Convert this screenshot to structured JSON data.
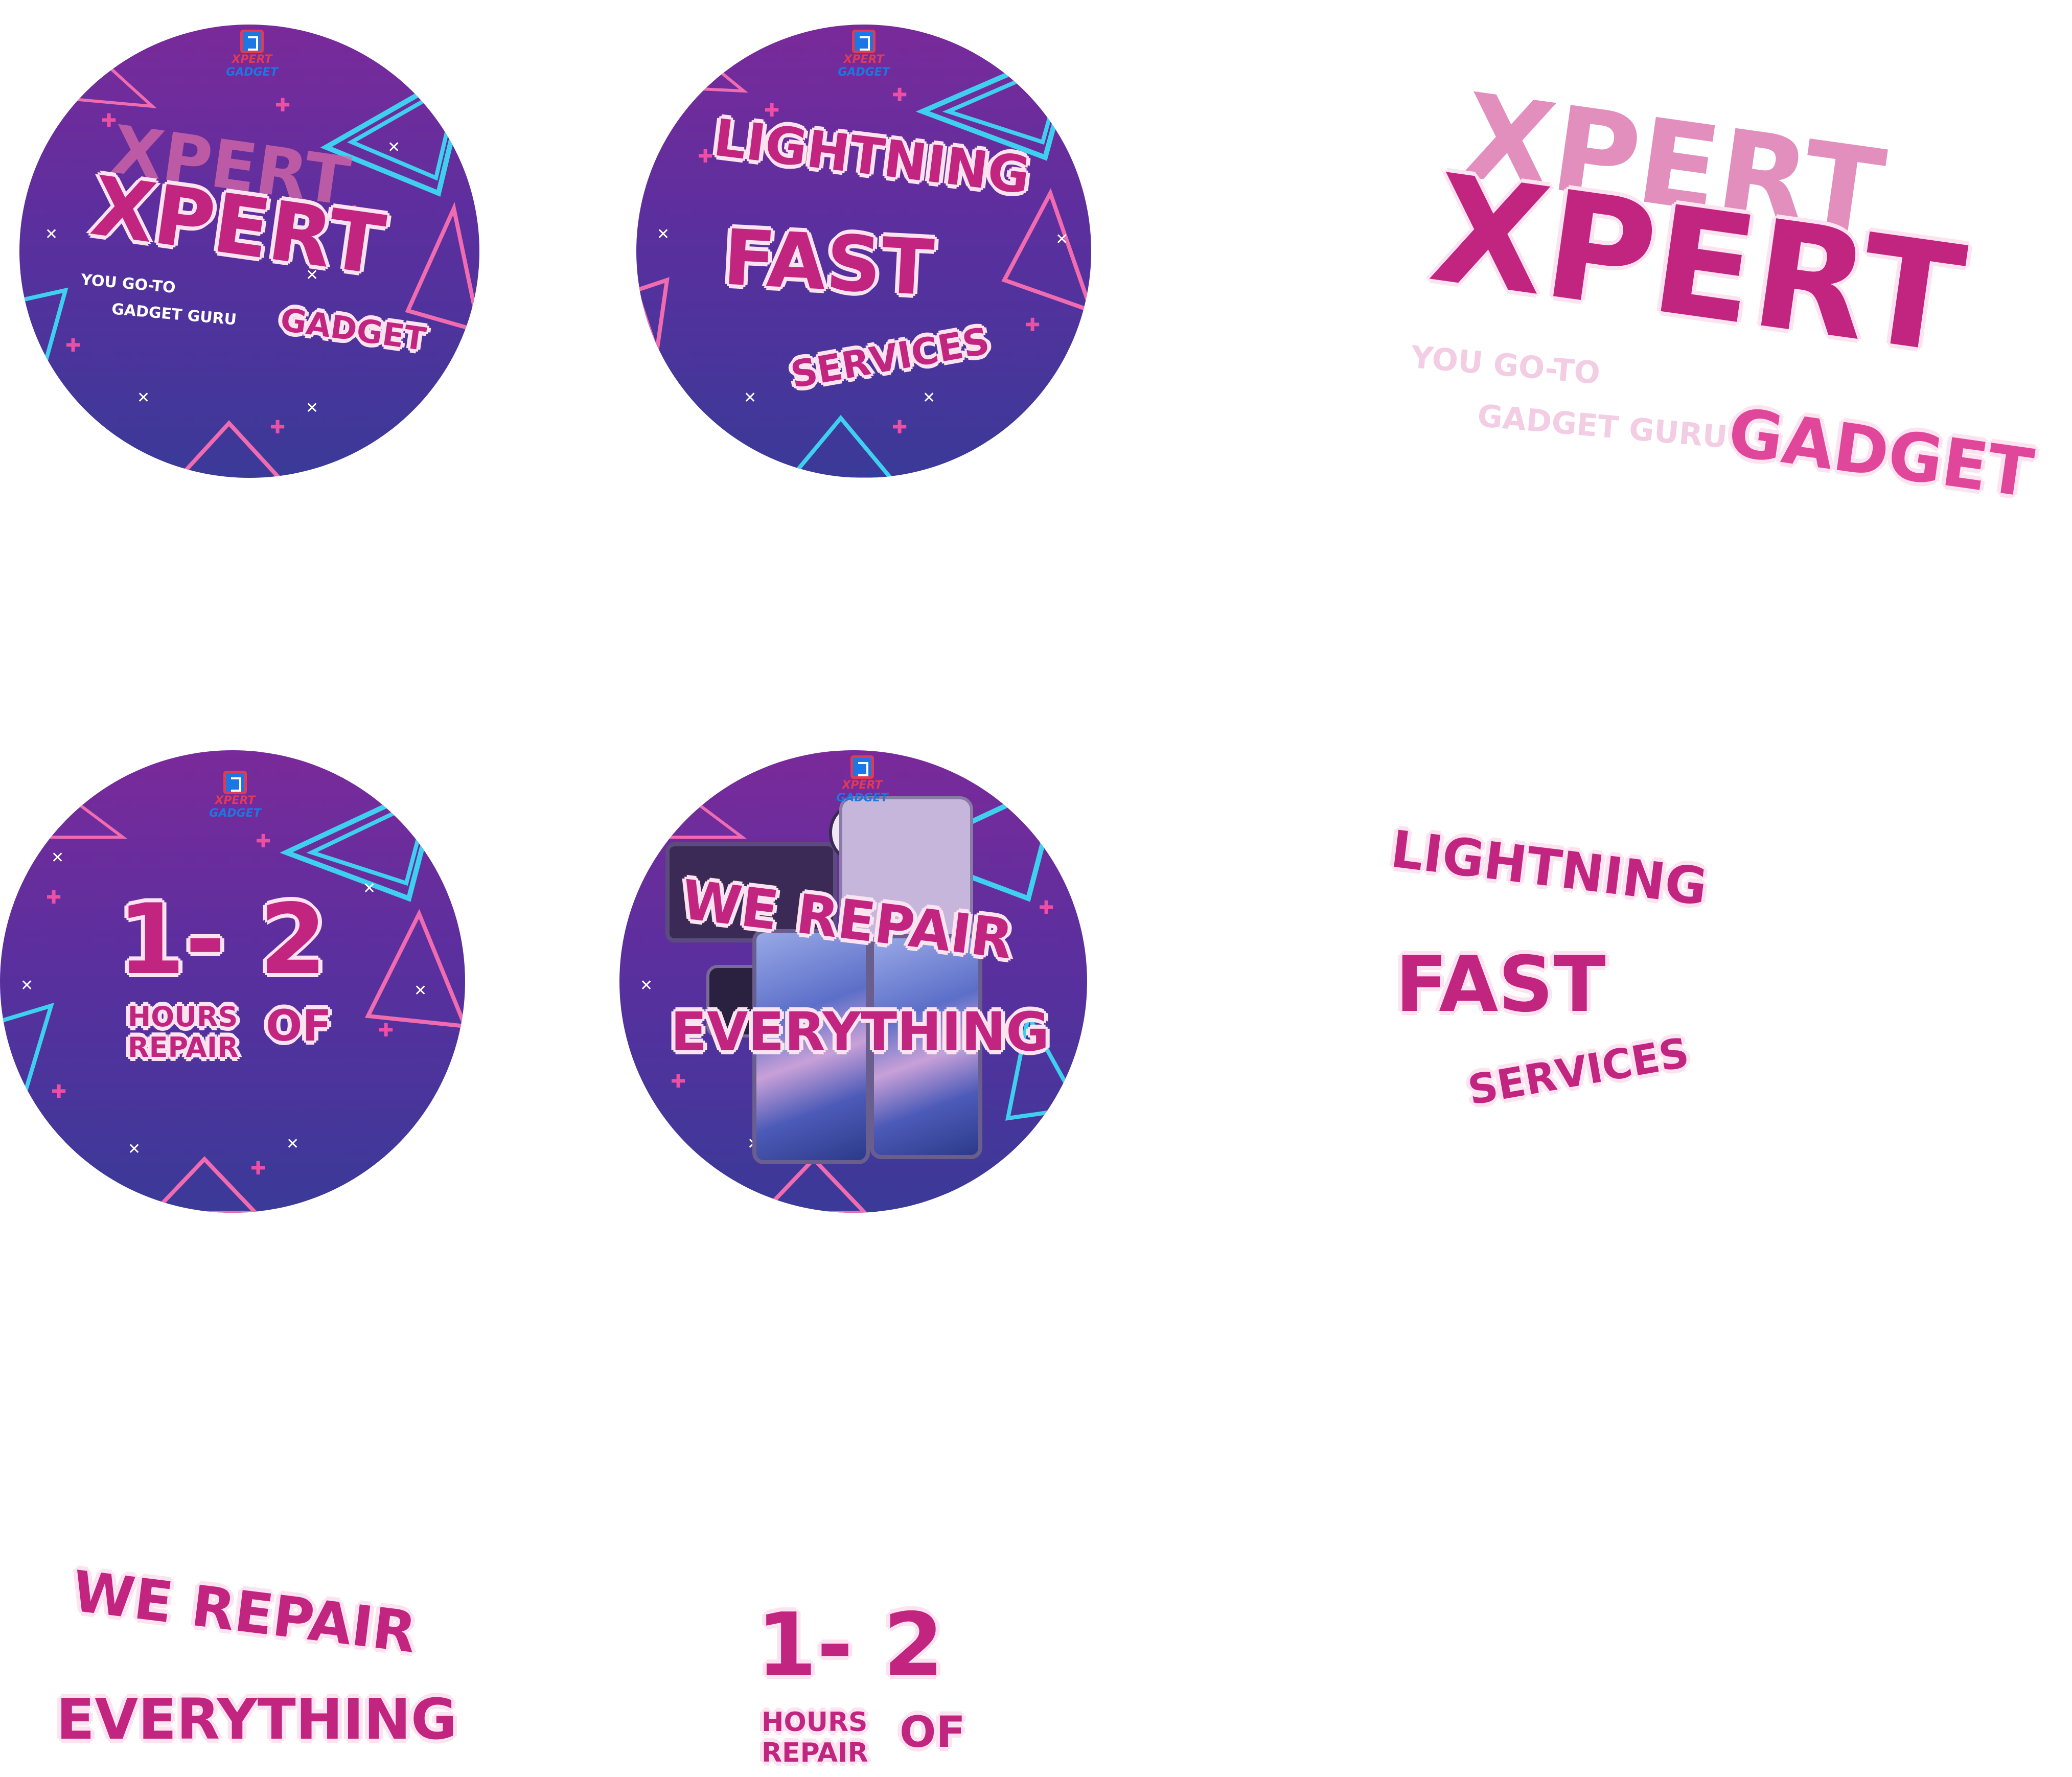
{
  "brand": {
    "logo_word_1": "XPERT",
    "logo_word_2": "GADGET"
  },
  "colors": {
    "pink": "#c2257f",
    "pink_light": "#fbe3f0",
    "circle_top": "#7a2a9a",
    "circle_bottom": "#3a3a98",
    "cyan": "#3fd0f0"
  },
  "sticker_xpert": {
    "big": "XPERT",
    "ghost": "XPERT",
    "tagline_1": "YOU GO-TO",
    "tagline_2": "GADGET GURU",
    "small": "GADGET"
  },
  "sticker_fast": {
    "line_1": "LIGHTNING",
    "line_2": "FAST",
    "line_3": "SERVICES"
  },
  "sticker_hours": {
    "line_1": "1- 2",
    "line_2": "HOURS",
    "line_3": "REPAIR",
    "line_4": "OF"
  },
  "sticker_repair": {
    "line_1": "WE REPAIR",
    "line_2": "EVERYTHING"
  }
}
